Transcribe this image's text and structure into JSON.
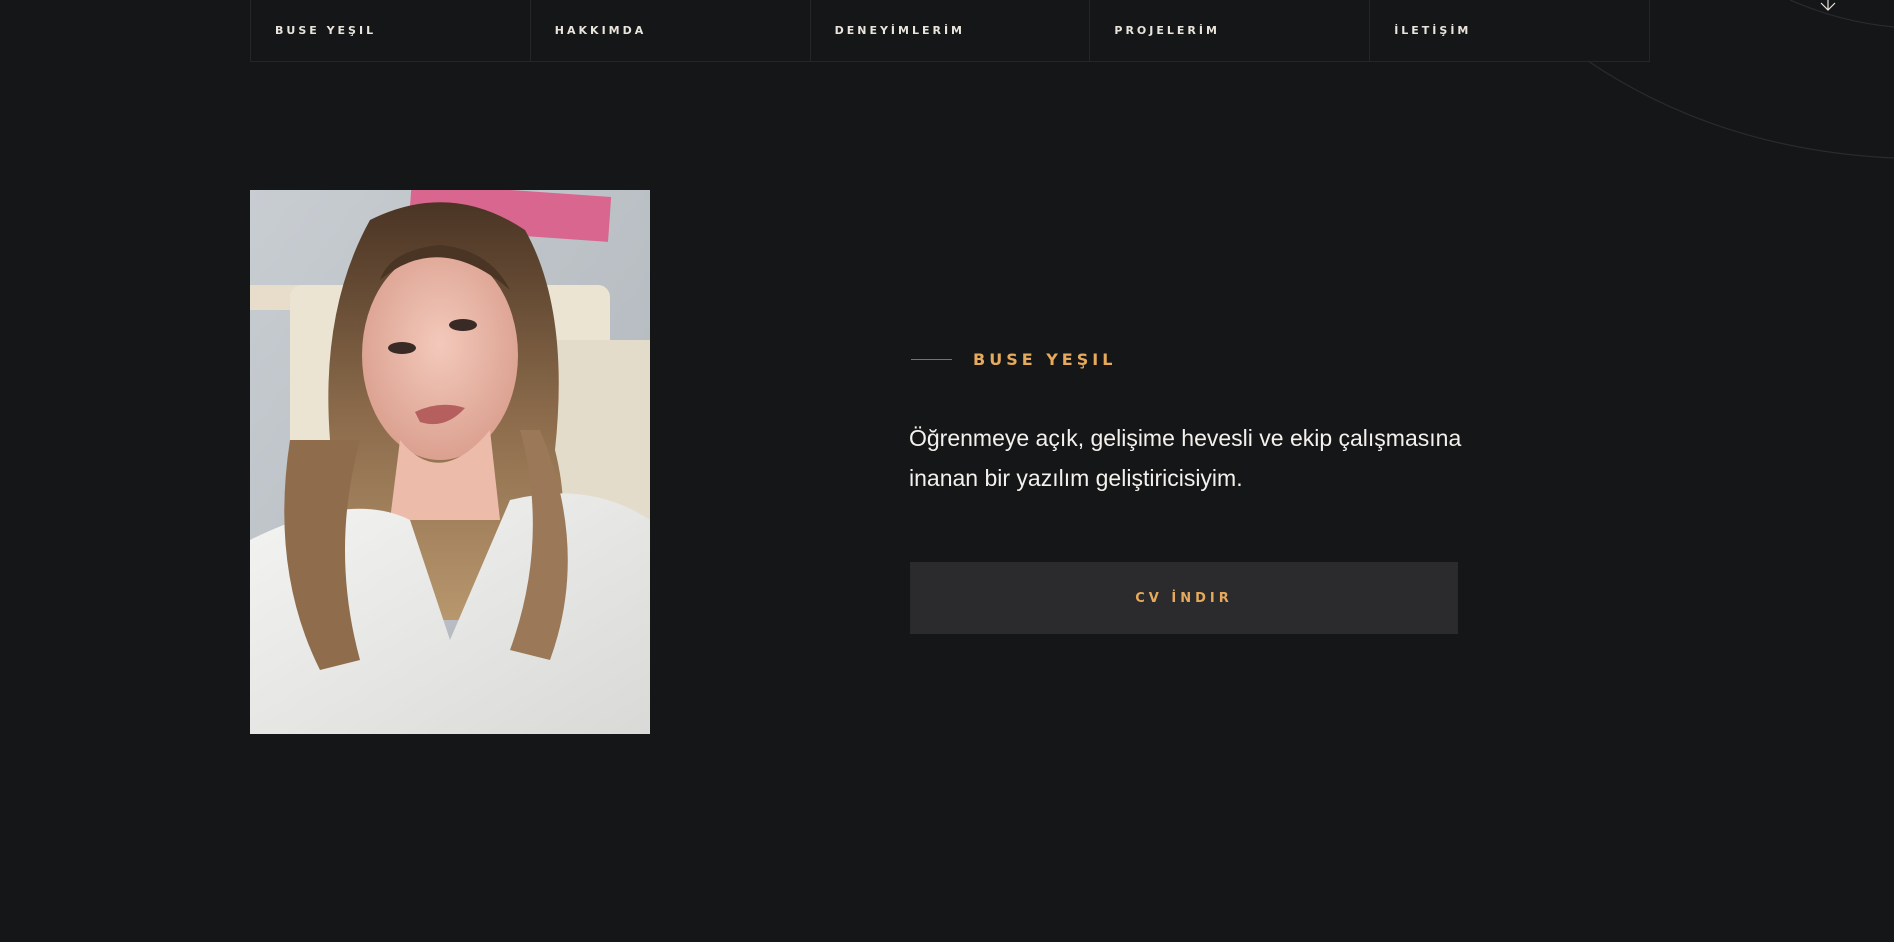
{
  "nav": {
    "items": [
      {
        "label": "BUSE YEŞIL"
      },
      {
        "label": "HAKKIMDA"
      },
      {
        "label": "DENEYİMLERİM"
      },
      {
        "label": "PROJELERİM"
      },
      {
        "label": "İLETİŞİM"
      }
    ]
  },
  "hero": {
    "eyebrow": "BUSE YEŞIL",
    "intro": "Öğrenmeye açık, gelişime hevesli ve ekip çalışmasına inanan bir yazılım geliştiricisiyim.",
    "cv_button_label": "CV İNDIR"
  },
  "colors": {
    "background": "#151618",
    "accent": "#e7a95b",
    "text": "#f4f1ec",
    "button_bg": "#2b2b2d"
  },
  "icons": [
    "down-arrow-icon"
  ]
}
